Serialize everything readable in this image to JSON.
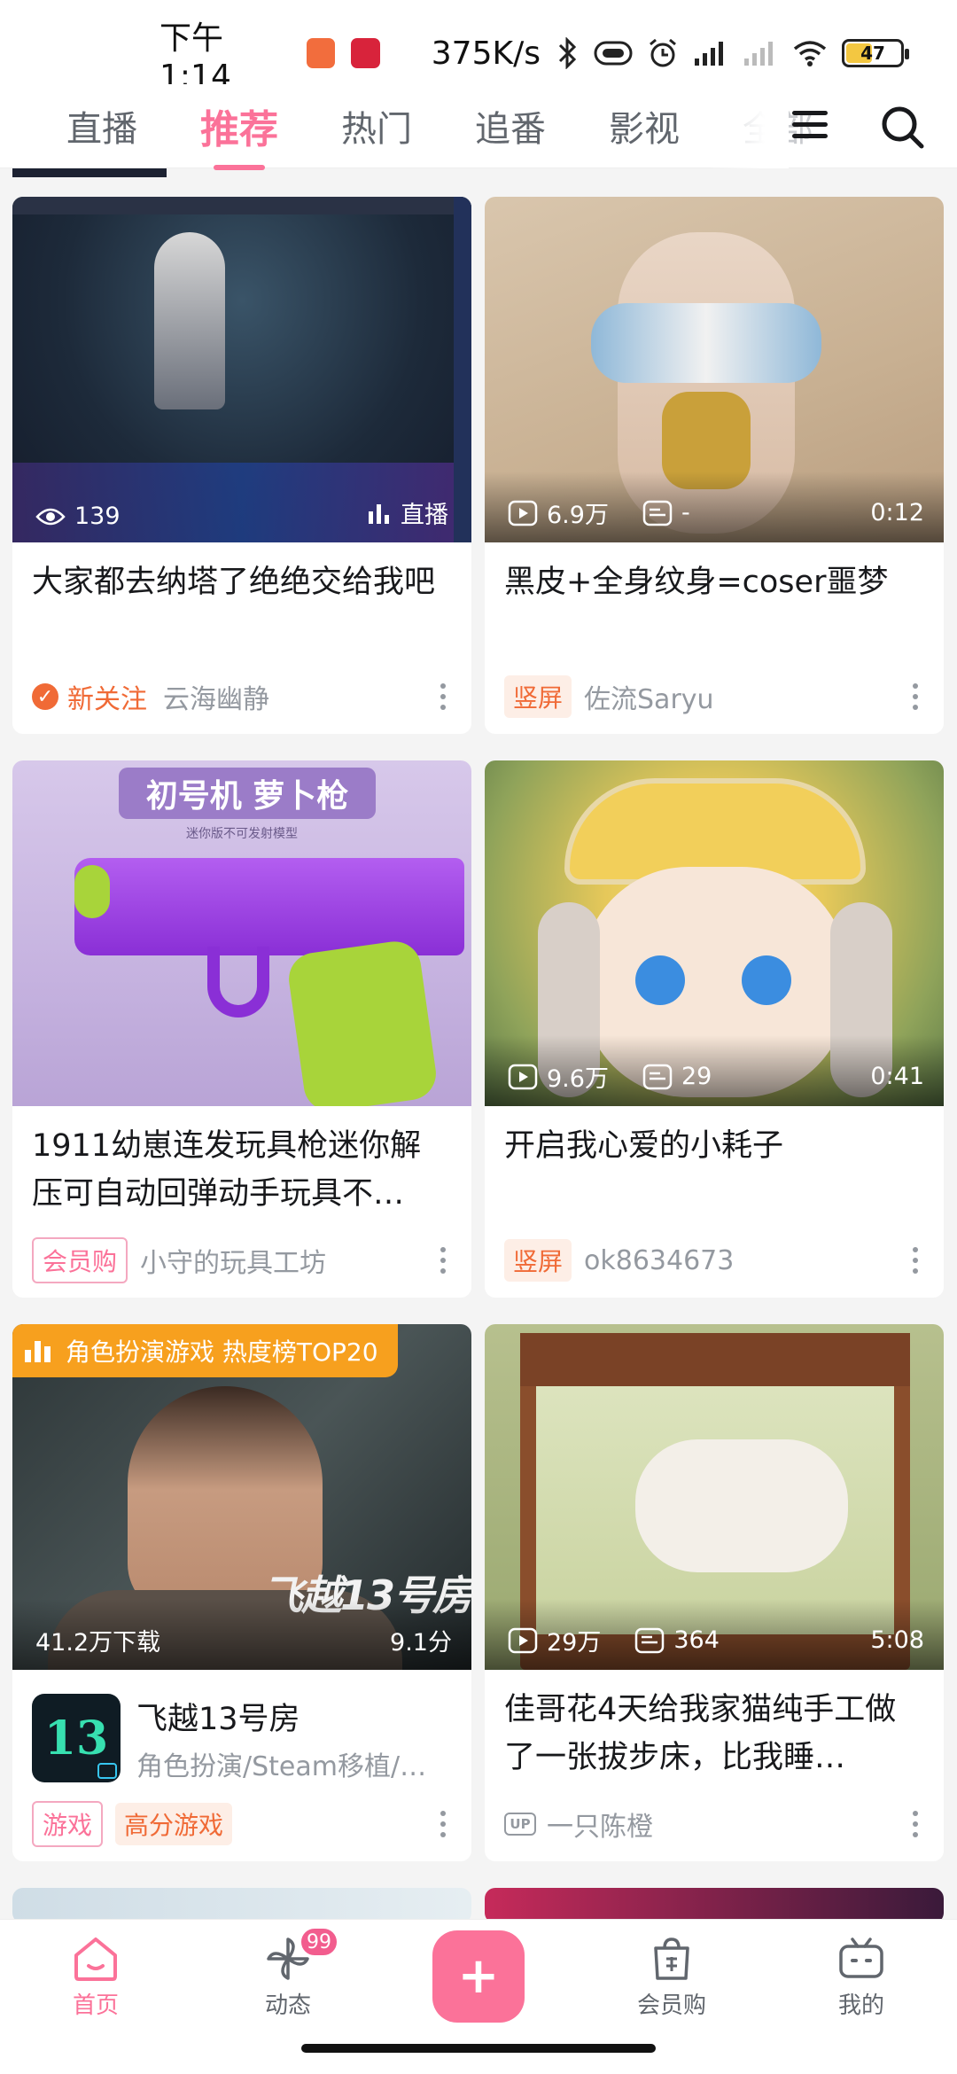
{
  "status_bar": {
    "time": "下午1:14",
    "net_rate": "375K/s",
    "battery": "47",
    "battery_level": 0.47
  },
  "top_tabs": [
    {
      "label": "直播"
    },
    {
      "label": "推荐"
    },
    {
      "label": "热门"
    },
    {
      "label": "追番"
    },
    {
      "label": "影视"
    },
    {
      "label": "全部"
    }
  ],
  "active_tab": "推荐",
  "cards": [
    {
      "title": "大家都去纳塔了绝绝交给我吧",
      "views": "139",
      "live_label": "直播",
      "follow_label": "新关注",
      "author": "云海幽静"
    },
    {
      "title": "黑皮+全身纹身=coser噩梦",
      "views": "6.9万",
      "comments": "-",
      "duration": "0:12",
      "badge": "竖屏",
      "author": "佐流Saryu"
    },
    {
      "title": "1911幼崽连发玩具枪迷你解压可自动回弹动手玩具不…",
      "badge": "会员购",
      "author": "小守的玩具工坊",
      "thumb_text_big": "初号机 萝卜枪",
      "thumb_text_small": "迷你版不可发射模型"
    },
    {
      "title": "开启我心爱的小耗子",
      "views": "9.6万",
      "comments": "29",
      "duration": "0:41",
      "badge": "竖屏",
      "author": "ok8634673"
    },
    {
      "rank_banner": "角色扮演游戏 热度榜TOP20",
      "downloads": "41.2万下载",
      "score": "9.1分",
      "thumb_logo_text": "飞越13号房",
      "game_name": "飞越13号房",
      "game_category": "角色扮演/Steam移植/…",
      "game_logo_text": "13",
      "badge": "游戏",
      "badge2": "高分游戏"
    },
    {
      "title": "佳哥花4天给我家猫纯手工做了一张拔步床，比我睡…",
      "views": "29万",
      "comments": "364",
      "duration": "5:08",
      "up_label": "UP",
      "author": "一只陈橙"
    }
  ],
  "bottom_nav": {
    "home": "首页",
    "dynamic": "动态",
    "dynamic_badge": "99",
    "plus": "+",
    "mall": "会员购",
    "mine": "我的"
  },
  "colors": {
    "brand_pink": "#fb7299",
    "orange": "#f06a36",
    "rank_orange": "#f7a01e"
  }
}
